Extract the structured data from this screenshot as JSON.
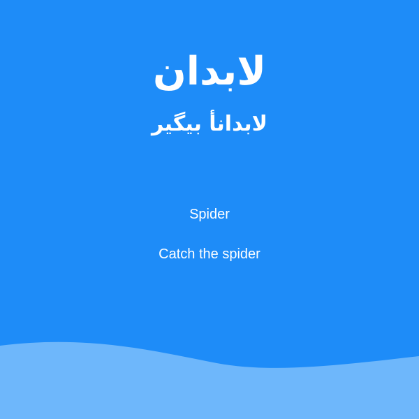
{
  "colors": {
    "background": "#1e8cf8",
    "wave": "#6eb7fb",
    "text": "#ffffff"
  },
  "header": {
    "title": "لابدان",
    "subtitle": "لابدانأ بیگیر"
  },
  "content": {
    "line1": "Spider",
    "line2": "Catch the spider"
  },
  "decor": {
    "wave_icon": "wave-shape"
  }
}
